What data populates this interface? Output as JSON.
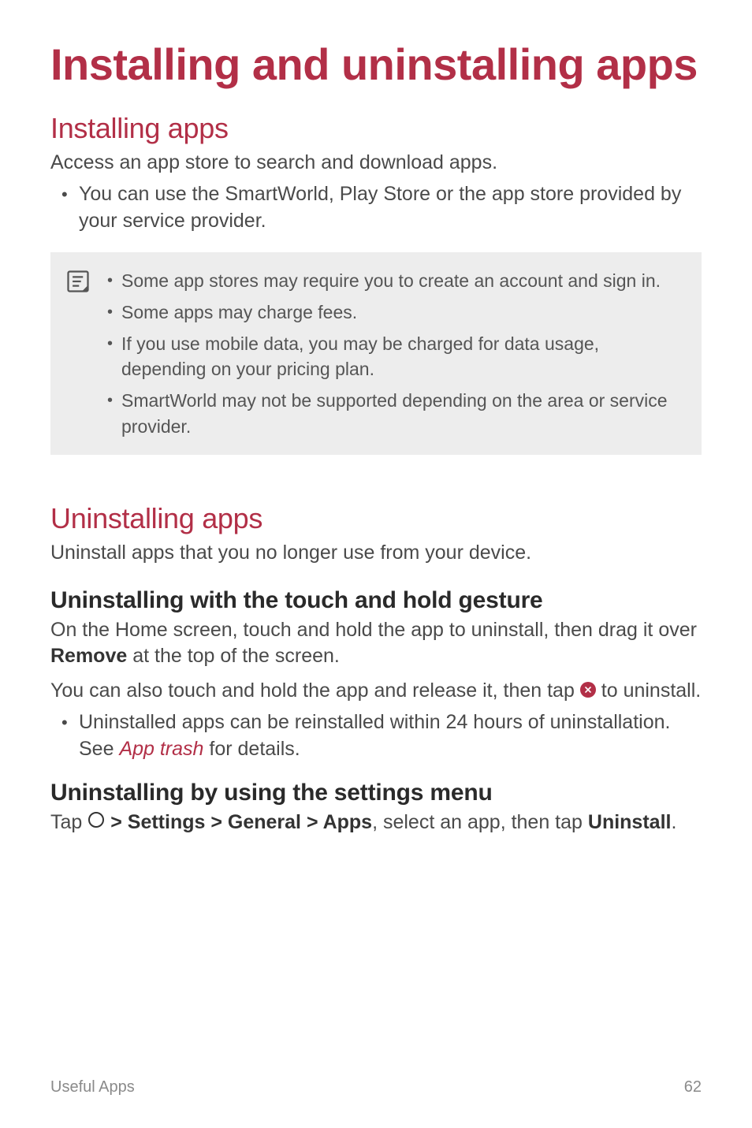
{
  "title": "Installing and uninstalling apps",
  "installing": {
    "heading": "Installing apps",
    "intro": "Access an app store to search and download apps.",
    "bullets": [
      "You can use the SmartWorld, Play Store or the app store provided by your service provider."
    ]
  },
  "note": {
    "items": [
      "Some app stores may require you to create an account and sign in.",
      "Some apps may charge fees.",
      "If you use mobile data, you may be charged for data usage, depending on your pricing plan.",
      "SmartWorld may not be supported depending on the area or service provider."
    ]
  },
  "uninstalling": {
    "heading": "Uninstalling apps",
    "intro": "Uninstall apps that you no longer use from your device.",
    "touchhold": {
      "heading": "Uninstalling with the touch and hold gesture",
      "p1_pre": "On the Home screen, touch and hold the app to uninstall, then drag it over ",
      "p1_bold": "Remove",
      "p1_post": " at the top of the screen.",
      "p2_pre": "You can also touch and hold the app and release it, then tap ",
      "p2_post": " to uninstall.",
      "bullets_pre": "Uninstalled apps can be reinstalled within 24 hours of uninstallation. See ",
      "bullets_link": "App trash",
      "bullets_post": " for details."
    },
    "settings": {
      "heading": "Uninstalling by using the settings menu",
      "tap": "Tap ",
      "gt1": " ",
      "path1": "Settings",
      "gt": " > ",
      "path2": "General",
      "path3": "Apps",
      "tail": ", select an app, then tap ",
      "uninstall": "Uninstall",
      "period": "."
    }
  },
  "footer": {
    "section": "Useful Apps",
    "page": "62"
  }
}
